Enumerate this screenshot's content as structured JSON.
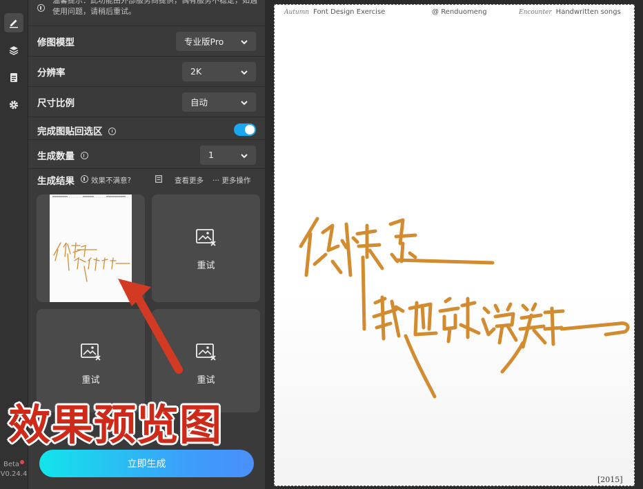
{
  "notice": {
    "text": "温馨提示：此功能由外部服务商提供，偶有服务不稳定，如遇使用问题，请稍后重试。"
  },
  "settings": {
    "model_label": "修图模型",
    "model_value": "专业版Pro",
    "resolution_label": "分辨率",
    "resolution_value": "2K",
    "ratio_label": "尺寸比例",
    "ratio_value": "自动",
    "paste_back_label": "完成图贴回选区",
    "paste_back_enabled": true,
    "count_label": "生成数量",
    "count_value": "1"
  },
  "results": {
    "title": "生成结果",
    "unsatisfied": "效果不满意?",
    "view_more": "查看更多",
    "more_ops": "··· 更多操作",
    "retry_label": "重试"
  },
  "overlay_caption": "效果预览图",
  "generate_button": "立即生成",
  "version": {
    "beta": "Beta",
    "number": "V0.24.4"
  },
  "preview": {
    "head_left_script": "Autumn",
    "head_left": "Font Design Exercise",
    "head_center": "Renduomeng",
    "head_right_script": "Encounter",
    "head_right": "Handwritten songs",
    "stamp": "[2015]"
  },
  "colors": {
    "accent": "#19a8f0",
    "generate_gradient_start": "#12e5ea",
    "generate_gradient_end": "#4a8ff8",
    "calligraphy": "#d38b2f",
    "overlay_red": "#ce2a1a"
  }
}
